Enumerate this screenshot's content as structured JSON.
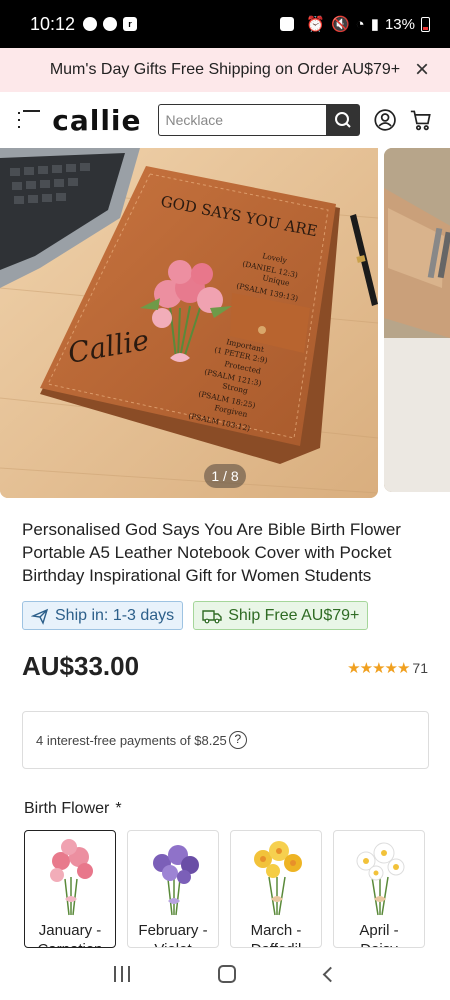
{
  "status_bar": {
    "time": "10:12",
    "battery": "13%"
  },
  "promo": {
    "text": "Mum's Day Gifts Free Shipping on Order AU$79+",
    "close": "×"
  },
  "header": {
    "logo": "callie",
    "search_placeholder": "Necklace"
  },
  "gallery": {
    "counter": "1 / 8"
  },
  "product": {
    "title": "Personalised God Says You Are Bible Birth Flower Portable A5 Leather Notebook Cover with Pocket Birthday Inspirational Gift for Women Students",
    "ship_badge": "Ship in: 1-3 days",
    "free_badge": "Ship Free AU$79+",
    "price": "AU$33.00",
    "stars": "★★★★★",
    "rating_count": "71",
    "installments": "4 interest-free payments of $8.25"
  },
  "image_text": {
    "heading": "GOD SAYS YOU ARE",
    "name": "Callie",
    "verses": [
      "Lovely",
      "(DANIEL 12:3)",
      "Unique",
      "(PSALM 139:13)",
      "Important",
      "(1 PETER 2:9)",
      "Protected",
      "(PSALM 121:3)",
      "Strong",
      "(PSALM 18:25)",
      "Forgiven",
      "(PSALM 103:12)"
    ]
  },
  "birth_flower": {
    "label": "Birth Flower",
    "required": "*",
    "options": [
      {
        "line1": "January -",
        "line2": "Carnation",
        "color": "#e87a8c"
      },
      {
        "line1": "February -",
        "line2": "Violet",
        "color": "#7b5fb8"
      },
      {
        "line1": "March -",
        "line2": "Daffodil",
        "color": "#f2c23a"
      },
      {
        "line1": "April -",
        "line2": "Daisy",
        "color": "#ffffff"
      }
    ]
  }
}
